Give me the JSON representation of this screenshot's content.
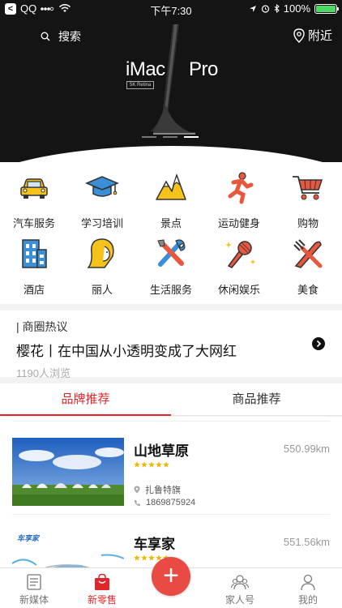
{
  "status_bar": {
    "carrier": "QQ",
    "time": "下午7:30",
    "battery": "100%",
    "battery_level": 1.0
  },
  "header": {
    "search_label": "搜索",
    "nearby_label": "附近"
  },
  "banner": {
    "title_left": "iMac",
    "title_right": "Pro",
    "subtitle": "5K Retina",
    "slide_count": 3,
    "active_slide": 3
  },
  "categories": [
    {
      "label": "汽车服务",
      "icon": "car-icon"
    },
    {
      "label": "学习培训",
      "icon": "graduation-cap-icon"
    },
    {
      "label": "景点",
      "icon": "mountain-icon"
    },
    {
      "label": "运动健身",
      "icon": "running-icon"
    },
    {
      "label": "购物",
      "icon": "cart-icon"
    },
    {
      "label": "酒店",
      "icon": "hotel-icon"
    },
    {
      "label": "丽人",
      "icon": "woman-icon"
    },
    {
      "label": "生活服务",
      "icon": "tools-icon"
    },
    {
      "label": "休闲娱乐",
      "icon": "microphone-icon"
    },
    {
      "label": "美食",
      "icon": "fork-knife-icon"
    }
  ],
  "hot_topic": {
    "tag": "| 商圈热议",
    "title": "樱花丨在中国从小透明变成了大网红",
    "views": "1190人浏览"
  },
  "tabs": [
    {
      "label": "品牌推荐",
      "active": true
    },
    {
      "label": "商品推荐",
      "active": false
    }
  ],
  "list": [
    {
      "name": "山地草原",
      "distance": "550.99km",
      "rating": 5,
      "location": "扎鲁特旗",
      "phone": "1869875924"
    },
    {
      "name": "车享家",
      "distance": "551.56km",
      "rating": 5,
      "thumb_logo": "车享家"
    }
  ],
  "tabbar": {
    "items": [
      {
        "label": "新媒体",
        "icon": "document-icon",
        "active": false
      },
      {
        "label": "新零售",
        "icon": "shopping-bag-icon",
        "active": true
      },
      {
        "label": "家人号",
        "icon": "family-icon",
        "active": false
      },
      {
        "label": "我的",
        "icon": "person-icon",
        "active": false
      }
    ],
    "add_label": "+"
  },
  "colors": {
    "accent": "#e0262b",
    "hero_bg": "#141414",
    "icon_blue": "#3a8fd6",
    "icon_yellow": "#f5c21b",
    "icon_red": "#e9573f",
    "star": "#f5b400"
  }
}
